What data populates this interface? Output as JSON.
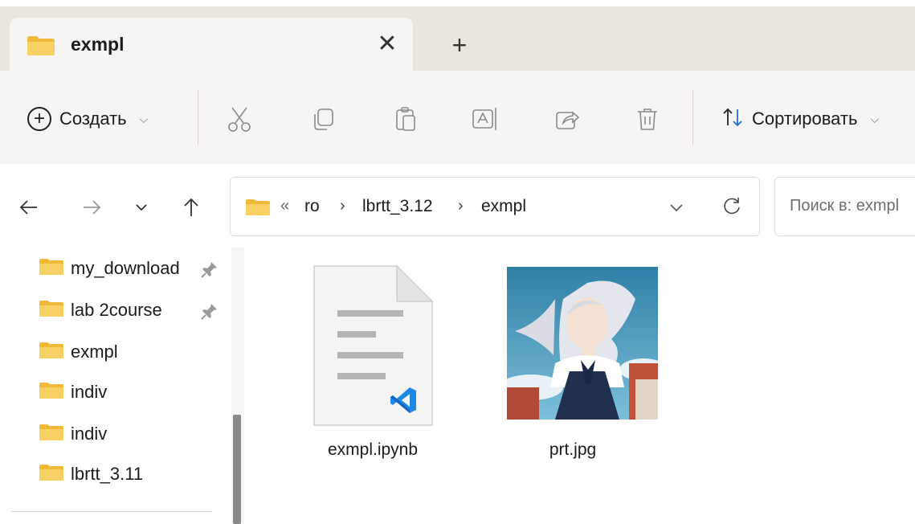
{
  "tab": {
    "title": "exmpl",
    "close_glyph": "✕",
    "new_tab_glyph": "+"
  },
  "toolbar": {
    "create_label": "Создать",
    "sort_label": "Сортировать",
    "icons": [
      "cut-icon",
      "copy-icon",
      "paste-icon",
      "rename-icon",
      "share-icon",
      "delete-icon"
    ]
  },
  "address": {
    "overflow_glyph": "«",
    "crumbs": [
      "ro",
      "lbrtt_3.12",
      "exmpl"
    ],
    "separator": "›"
  },
  "search": {
    "placeholder": "Поиск в: exmpl"
  },
  "sidebar": {
    "items": [
      {
        "label": "my_download",
        "pinned": true
      },
      {
        "label": "lab 2course",
        "pinned": true
      },
      {
        "label": "exmpl",
        "pinned": false
      },
      {
        "label": "indiv",
        "pinned": false
      },
      {
        "label": "indiv",
        "pinned": false
      },
      {
        "label": "lbrtt_3.11",
        "pinned": false
      }
    ]
  },
  "files": [
    {
      "name": "exmpl.ipynb",
      "type": "ipynb",
      "icon": "vscode-document-icon"
    },
    {
      "name": "prt.jpg",
      "type": "jpg",
      "icon": "image-thumbnail"
    }
  ],
  "colors": {
    "tabbar_bg": "#e9e6dd",
    "toolbar_bg": "#f7f5f1",
    "folder_yellow": "#f4c542",
    "vscode_blue": "#1e88e5"
  }
}
